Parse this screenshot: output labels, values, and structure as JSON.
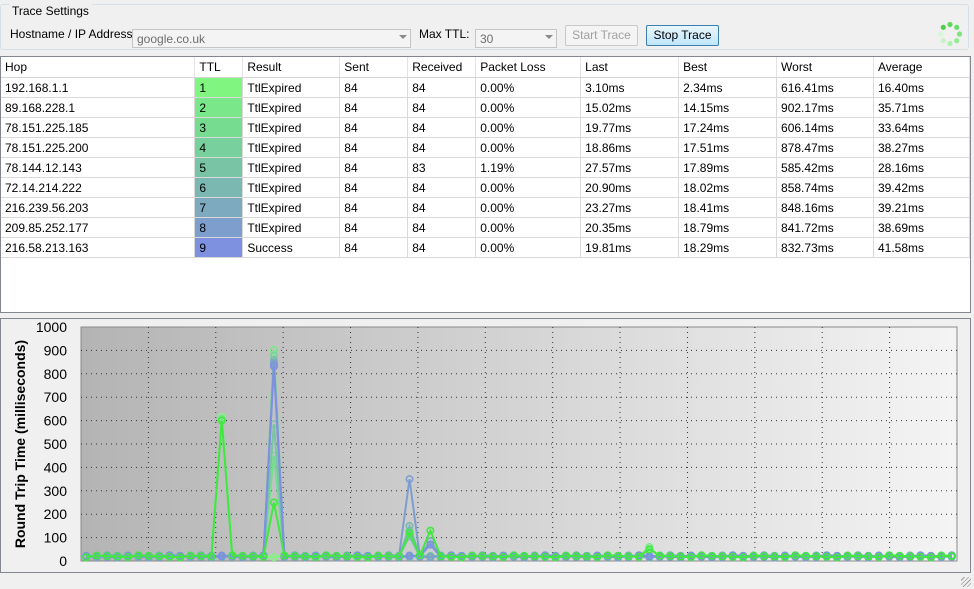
{
  "settings": {
    "group_title": "Trace Settings",
    "hostname_label": "Hostname / IP Address:",
    "hostname_value": "google.co.uk",
    "maxttl_label": "Max TTL:",
    "maxttl_value": "30",
    "start_label": "Start Trace",
    "stop_label": "Stop Trace"
  },
  "table": {
    "headers": [
      "Hop",
      "TTL",
      "Result",
      "Sent",
      "Received",
      "Packet Loss",
      "Last",
      "Best",
      "Worst",
      "Average"
    ],
    "rows": [
      {
        "hop": "192.168.1.1",
        "ttl": "1",
        "result": "TtlExpired",
        "sent": "84",
        "received": "84",
        "loss": "0.00%",
        "last": "3.10ms",
        "best": "2.34ms",
        "worst": "616.41ms",
        "avg": "16.40ms",
        "color": "#80f580"
      },
      {
        "hop": "89.168.228.1",
        "ttl": "2",
        "result": "TtlExpired",
        "sent": "84",
        "received": "84",
        "loss": "0.00%",
        "last": "15.02ms",
        "best": "14.15ms",
        "worst": "902.17ms",
        "avg": "35.71ms",
        "color": "#7ae88a"
      },
      {
        "hop": "78.151.225.185",
        "ttl": "3",
        "result": "TtlExpired",
        "sent": "84",
        "received": "84",
        "loss": "0.00%",
        "last": "19.77ms",
        "best": "17.24ms",
        "worst": "606.14ms",
        "avg": "33.64ms",
        "color": "#76dc90"
      },
      {
        "hop": "78.151.225.200",
        "ttl": "4",
        "result": "TtlExpired",
        "sent": "84",
        "received": "84",
        "loss": "0.00%",
        "last": "18.86ms",
        "best": "17.51ms",
        "worst": "878.47ms",
        "avg": "38.27ms",
        "color": "#78d09c"
      },
      {
        "hop": "78.144.12.143",
        "ttl": "5",
        "result": "TtlExpired",
        "sent": "84",
        "received": "83",
        "loss": "1.19%",
        "last": "27.57ms",
        "best": "17.89ms",
        "worst": "585.42ms",
        "avg": "28.16ms",
        "color": "#7ac4a6"
      },
      {
        "hop": "72.14.214.222",
        "ttl": "6",
        "result": "TtlExpired",
        "sent": "84",
        "received": "84",
        "loss": "0.00%",
        "last": "20.90ms",
        "best": "18.02ms",
        "worst": "858.74ms",
        "avg": "39.42ms",
        "color": "#7cb8b2"
      },
      {
        "hop": "216.239.56.203",
        "ttl": "7",
        "result": "TtlExpired",
        "sent": "84",
        "received": "84",
        "loss": "0.00%",
        "last": "23.27ms",
        "best": "18.41ms",
        "worst": "848.16ms",
        "avg": "39.21ms",
        "color": "#7eaac0"
      },
      {
        "hop": "209.85.252.177",
        "ttl": "8",
        "result": "TtlExpired",
        "sent": "84",
        "received": "84",
        "loss": "0.00%",
        "last": "20.35ms",
        "best": "18.79ms",
        "worst": "841.72ms",
        "avg": "38.69ms",
        "color": "#7e9ece"
      },
      {
        "hop": "216.58.213.163",
        "ttl": "9",
        "result": "Success",
        "sent": "84",
        "received": "84",
        "loss": "0.00%",
        "last": "19.81ms",
        "best": "18.29ms",
        "worst": "832.73ms",
        "avg": "41.58ms",
        "color": "#7e90e0"
      }
    ]
  },
  "chart_data": {
    "type": "line",
    "ylabel": "Round Trip Time (milliseconds)",
    "xlabel": "",
    "ylim": [
      0,
      1000
    ],
    "yticks": [
      "0",
      "100",
      "200",
      "300",
      "400",
      "500",
      "600",
      "700",
      "800",
      "900",
      "1000"
    ],
    "grid": true,
    "legend": "none",
    "samples": 84,
    "baseline_ms": 20,
    "series": [
      {
        "color": "#80f580",
        "spikes": [
          [
            13,
            616
          ],
          [
            42,
            22
          ]
        ]
      },
      {
        "color": "#7ae88a",
        "spikes": [
          [
            18,
            902
          ],
          [
            54,
            60
          ]
        ]
      },
      {
        "color": "#76dc90",
        "spikes": [
          [
            13,
            606
          ],
          [
            18,
            450
          ]
        ]
      },
      {
        "color": "#78d09c",
        "spikes": [
          [
            18,
            878
          ],
          [
            31,
            130
          ]
        ]
      },
      {
        "color": "#7ac4a6",
        "spikes": [
          [
            18,
            585
          ],
          [
            31,
            105
          ]
        ]
      },
      {
        "color": "#7cb8b2",
        "spikes": [
          [
            18,
            858
          ],
          [
            31,
            150
          ]
        ]
      },
      {
        "color": "#7eaac0",
        "spikes": [
          [
            18,
            848
          ],
          [
            33,
            85
          ]
        ]
      },
      {
        "color": "#7e9ece",
        "spikes": [
          [
            18,
            841
          ],
          [
            31,
            350
          ]
        ]
      },
      {
        "color": "#7e90e0",
        "spikes": [
          [
            18,
            832
          ],
          [
            33,
            70
          ]
        ]
      },
      {
        "color": "#40e840",
        "spikes": [
          [
            13,
            600
          ],
          [
            18,
            250
          ],
          [
            31,
            120
          ],
          [
            33,
            130
          ],
          [
            54,
            50
          ]
        ]
      }
    ]
  }
}
